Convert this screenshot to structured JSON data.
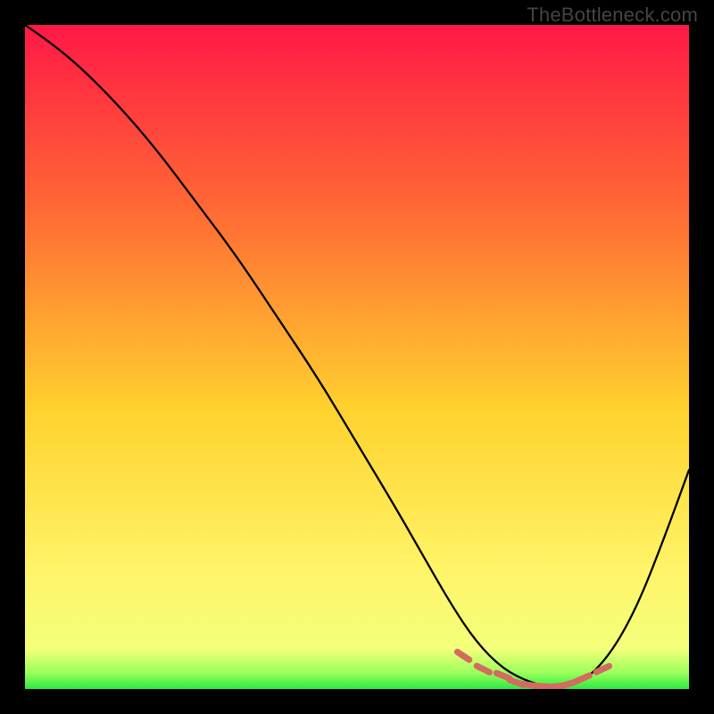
{
  "watermark": "TheBottleneck.com",
  "colors": {
    "frame": "#000000",
    "gradient_top": "#ff1846",
    "gradient_mid_upper": "#ff6a34",
    "gradient_mid": "#ffd22e",
    "gradient_lower": "#fff56a",
    "gradient_green": "#2eea41",
    "curve": "#000000",
    "marker": "#d46a60"
  },
  "chart_data": {
    "type": "line",
    "title": "",
    "xlabel": "",
    "ylabel": "",
    "xlim": [
      0,
      100
    ],
    "ylim": [
      0,
      100
    ],
    "series": [
      {
        "name": "bottleneck-curve",
        "x": [
          0,
          3,
          8,
          14,
          20,
          26,
          32,
          38,
          44,
          50,
          56,
          60,
          64,
          68,
          72,
          76,
          80,
          84,
          88,
          92,
          96,
          100
        ],
        "values": [
          100,
          98,
          94,
          88,
          81,
          73,
          65,
          56,
          47,
          37,
          27,
          20,
          13,
          7,
          3,
          1,
          0,
          1,
          5,
          12,
          22,
          33
        ]
      }
    ],
    "markers": {
      "name": "optimal-zone",
      "x": [
        66,
        69,
        72,
        74,
        76,
        78,
        80,
        82,
        84,
        87
      ],
      "values": [
        5,
        3,
        2,
        1,
        0.6,
        0.4,
        0.4,
        0.8,
        1.6,
        3
      ]
    }
  }
}
